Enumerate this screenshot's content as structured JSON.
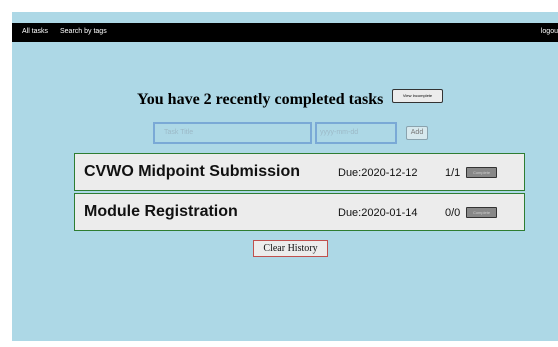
{
  "nav": {
    "all_tasks": "All tasks",
    "search_by_tags": "Search by tags",
    "logout": "logou"
  },
  "header": {
    "title": "You have 2 recently completed tasks",
    "view_incomplete_label": "View Incomplete"
  },
  "form": {
    "title_placeholder": "Task Title",
    "date_placeholder": "yyyy-mm-dd",
    "add_label": "Add"
  },
  "tasks": [
    {
      "title": "CVWO Midpoint Submission",
      "due": "Due:2020-12-12",
      "count": "1/1",
      "action_label": "Complete"
    },
    {
      "title": "Module Registration",
      "due": "Due:2020-01-14",
      "count": "0/0",
      "action_label": "Complete"
    }
  ],
  "footer": {
    "clear_history_label": "Clear History"
  },
  "colors": {
    "page_background": "#add8e6",
    "navbar": "#000000",
    "task_border": "#2e7d32",
    "clear_border": "#c0504d"
  }
}
